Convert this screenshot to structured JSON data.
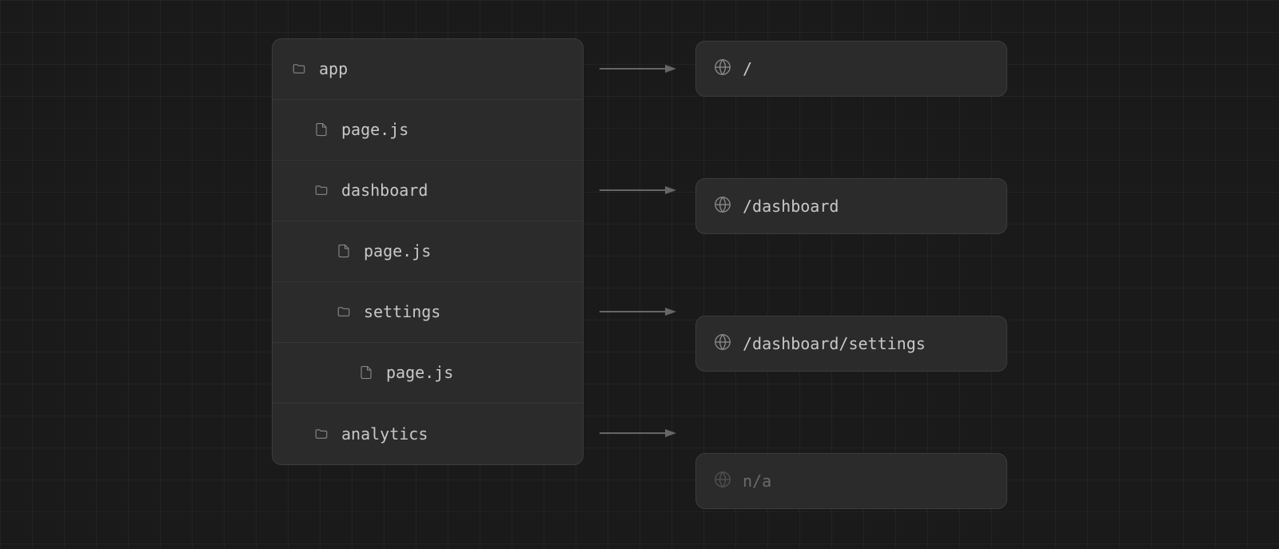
{
  "tree": {
    "items": [
      {
        "id": "app",
        "label": "app",
        "type": "folder",
        "level": 0
      },
      {
        "id": "page1",
        "label": "page.js",
        "type": "file",
        "level": 1
      },
      {
        "id": "dashboard",
        "label": "dashboard",
        "type": "folder",
        "level": 1
      },
      {
        "id": "page2",
        "label": "page.js",
        "type": "file",
        "level": 2
      },
      {
        "id": "settings",
        "label": "settings",
        "type": "folder",
        "level": 2
      },
      {
        "id": "page3",
        "label": "page.js",
        "type": "file",
        "level": 3
      },
      {
        "id": "analytics",
        "label": "analytics",
        "type": "folder",
        "level": 1
      }
    ]
  },
  "routes": [
    {
      "id": "route-root",
      "path": "/",
      "faded": false
    },
    {
      "id": "route-dashboard",
      "path": "/dashboard",
      "faded": false
    },
    {
      "id": "route-settings",
      "path": "/dashboard/settings",
      "faded": false
    },
    {
      "id": "route-analytics",
      "path": "n/a",
      "faded": true
    }
  ],
  "colors": {
    "bg": "#1a1a1a",
    "panel": "#2b2b2b",
    "border": "#3c3c3c",
    "text": "#c8c8c8",
    "icon": "#888888",
    "arrow": "#666666"
  }
}
